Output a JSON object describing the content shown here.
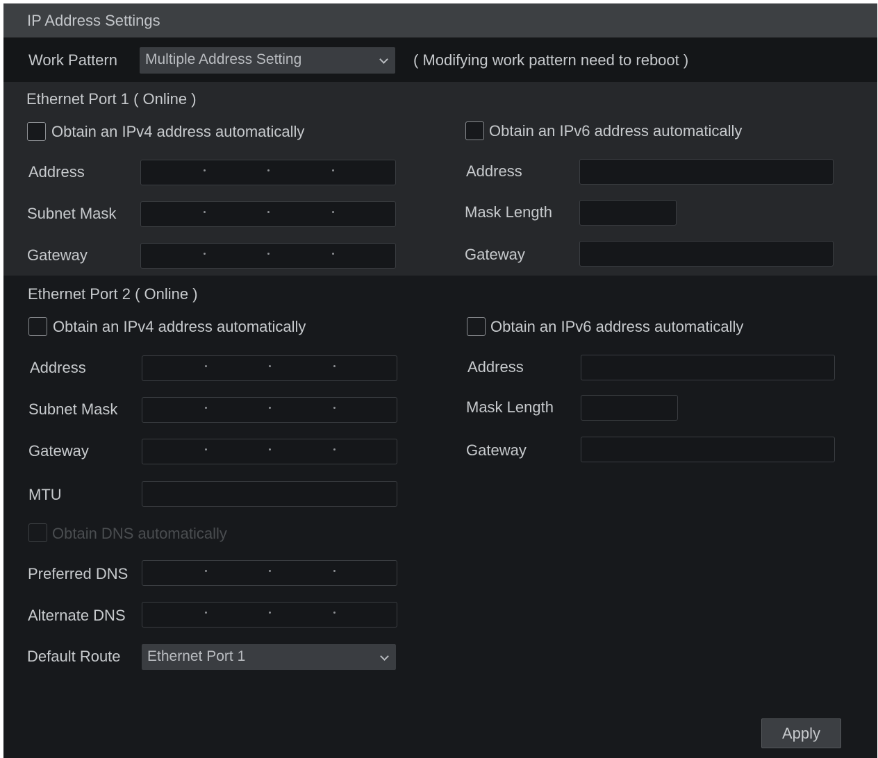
{
  "title": "IP Address Settings",
  "work_pattern": {
    "label": "Work Pattern",
    "value": "Multiple Address Setting",
    "note": "( Modifying work pattern need to reboot )"
  },
  "port1": {
    "header": "Ethernet Port 1 ( Online )",
    "ipv4_auto_label": "Obtain an IPv4 address automatically",
    "ipv4_auto_checked": false,
    "address_label": "Address",
    "subnet_label": "Subnet Mask",
    "gateway_label": "Gateway",
    "ipv6_auto_label": "Obtain an IPv6 address automatically",
    "ipv6_auto_checked": false,
    "ipv6_address_label": "Address",
    "mask_length_label": "Mask Length",
    "ipv6_gateway_label": "Gateway"
  },
  "port2": {
    "header": "Ethernet Port 2 ( Online )",
    "ipv4_auto_label": "Obtain an IPv4 address automatically",
    "ipv4_auto_checked": false,
    "address_label": "Address",
    "subnet_label": "Subnet Mask",
    "gateway_label": "Gateway",
    "mtu_label": "MTU",
    "dns_auto_label": "Obtain DNS automatically",
    "preferred_dns_label": "Preferred DNS",
    "alternate_dns_label": "Alternate DNS",
    "default_route_label": "Default Route",
    "default_route_value": "Ethernet Port 1",
    "ipv6_auto_label": "Obtain an IPv6 address automatically",
    "ipv6_auto_checked": false,
    "ipv6_address_label": "Address",
    "mask_length_label": "Mask Length",
    "ipv6_gateway_label": "Gateway"
  },
  "apply_label": "Apply",
  "colors": {
    "panel_bg": "#17191c",
    "section_bg": "#26282b",
    "titlebar_bg": "#3d4043",
    "text": "#c7cacd"
  }
}
